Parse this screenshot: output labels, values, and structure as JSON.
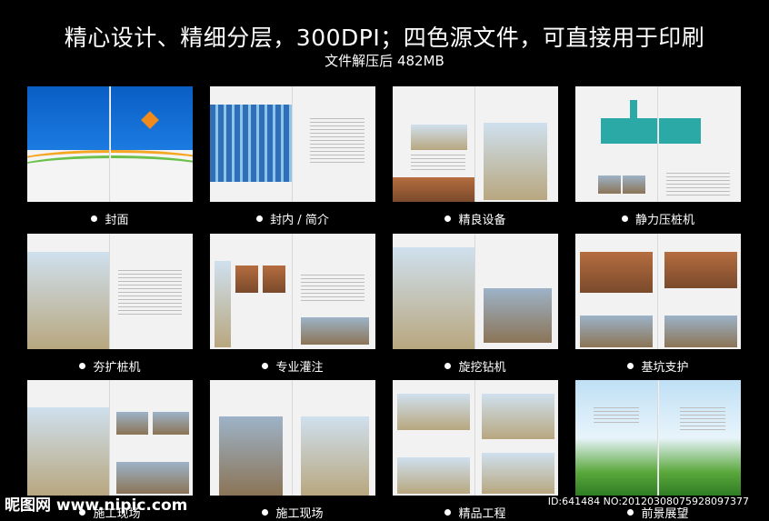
{
  "header": {
    "title": "精心设计、精细分层，300DPI；四色源文件，可直接用于印刷",
    "subtitle": "文件解压后 482MB"
  },
  "spreads": [
    {
      "label": "封面"
    },
    {
      "label": "封内 / 简介"
    },
    {
      "label": "精良设备"
    },
    {
      "label": "静力压桩机"
    },
    {
      "label": "夯扩桩机"
    },
    {
      "label": "专业灌注"
    },
    {
      "label": "旋挖钻机"
    },
    {
      "label": "基坑支护"
    },
    {
      "label": "施工现场"
    },
    {
      "label": "施工现场"
    },
    {
      "label": "精品工程"
    },
    {
      "label": "前景展望"
    }
  ],
  "watermark": {
    "site": "昵图网 www.nipic.com",
    "id": "ID:641484 NO:20120308075928097377"
  }
}
